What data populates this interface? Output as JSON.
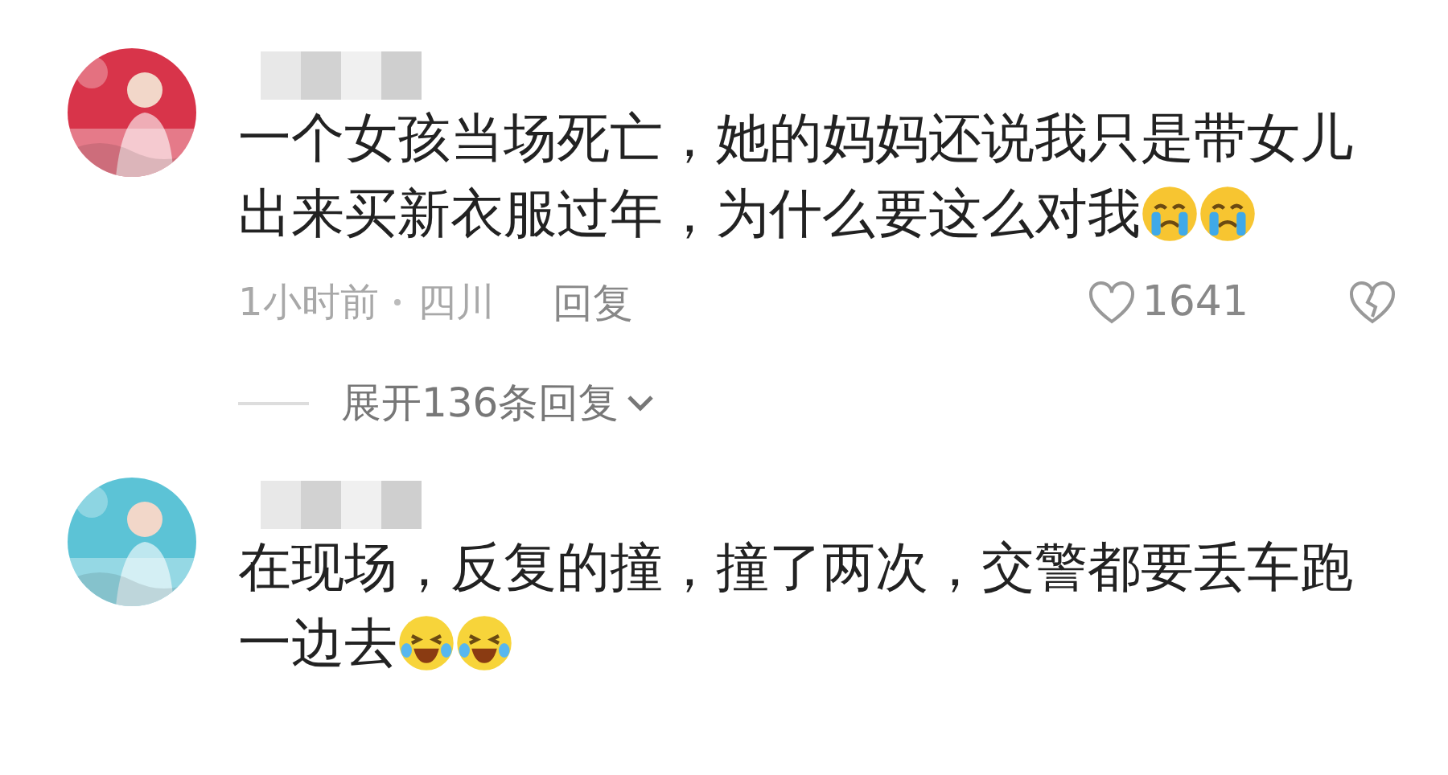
{
  "comments": [
    {
      "lines": [
        "一个女孩当场死亡，她的妈妈还说我只是带女儿",
        "出来买新衣服过年，为什么要这么对我"
      ],
      "emojis": [
        {
          "kind": "crying"
        },
        {
          "kind": "crying"
        }
      ],
      "time": "1小时前",
      "location": "四川",
      "reply": "回复",
      "likes": "1641",
      "expand": "展开136条回复"
    },
    {
      "lines": [
        "在现场，反复的撞，撞了两次，交警都要丢车跑",
        "一边去"
      ],
      "emojis": [
        {
          "kind": "laughing"
        },
        {
          "kind": "laughing"
        }
      ]
    }
  ]
}
